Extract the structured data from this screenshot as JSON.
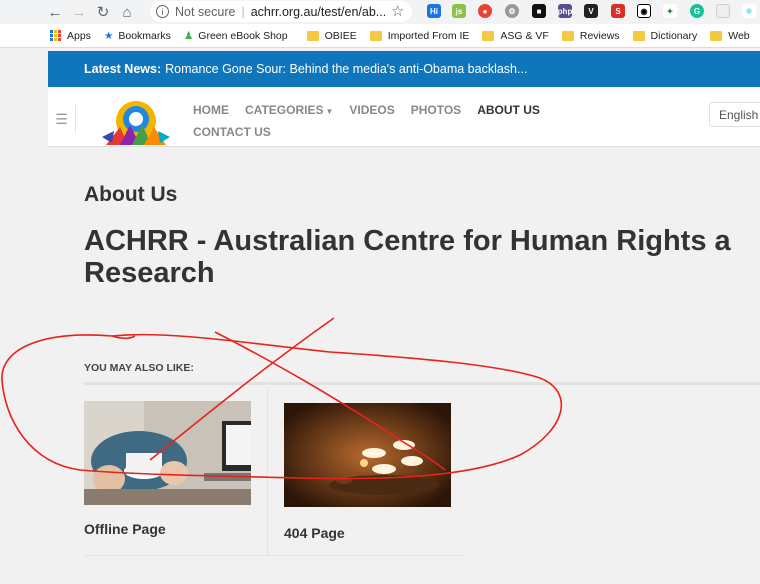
{
  "browser": {
    "url_security": "Not secure",
    "url": "achrr.org.au/test/en/ab...",
    "bookmarks": [
      "Apps",
      "Bookmarks",
      "Green eBook Shop",
      "OBIEE",
      "Imported From IE",
      "ASG & VF",
      "Reviews",
      "Dictionary",
      "Web"
    ]
  },
  "news": {
    "label": "Latest News:",
    "headline": "Romance Gone Sour: Behind the media's anti-Obama backlash..."
  },
  "nav": {
    "home": "HOME",
    "categories": "CATEGORIES",
    "videos": "VIDEOS",
    "photos": "PHOTOS",
    "about": "ABOUT US",
    "contact": "CONTACT US",
    "language": "English"
  },
  "main": {
    "page_heading": "About Us",
    "site_title": "ACHRR - Australian Centre for Human Rights a\nResearch",
    "related_heading": "YOU MAY ALSO LIKE:",
    "cards": [
      {
        "label": "Offline Page"
      },
      {
        "label": "404 Page"
      }
    ]
  },
  "colors": {
    "news_bar": "#0f76bc",
    "annotation": "#e8231b"
  }
}
